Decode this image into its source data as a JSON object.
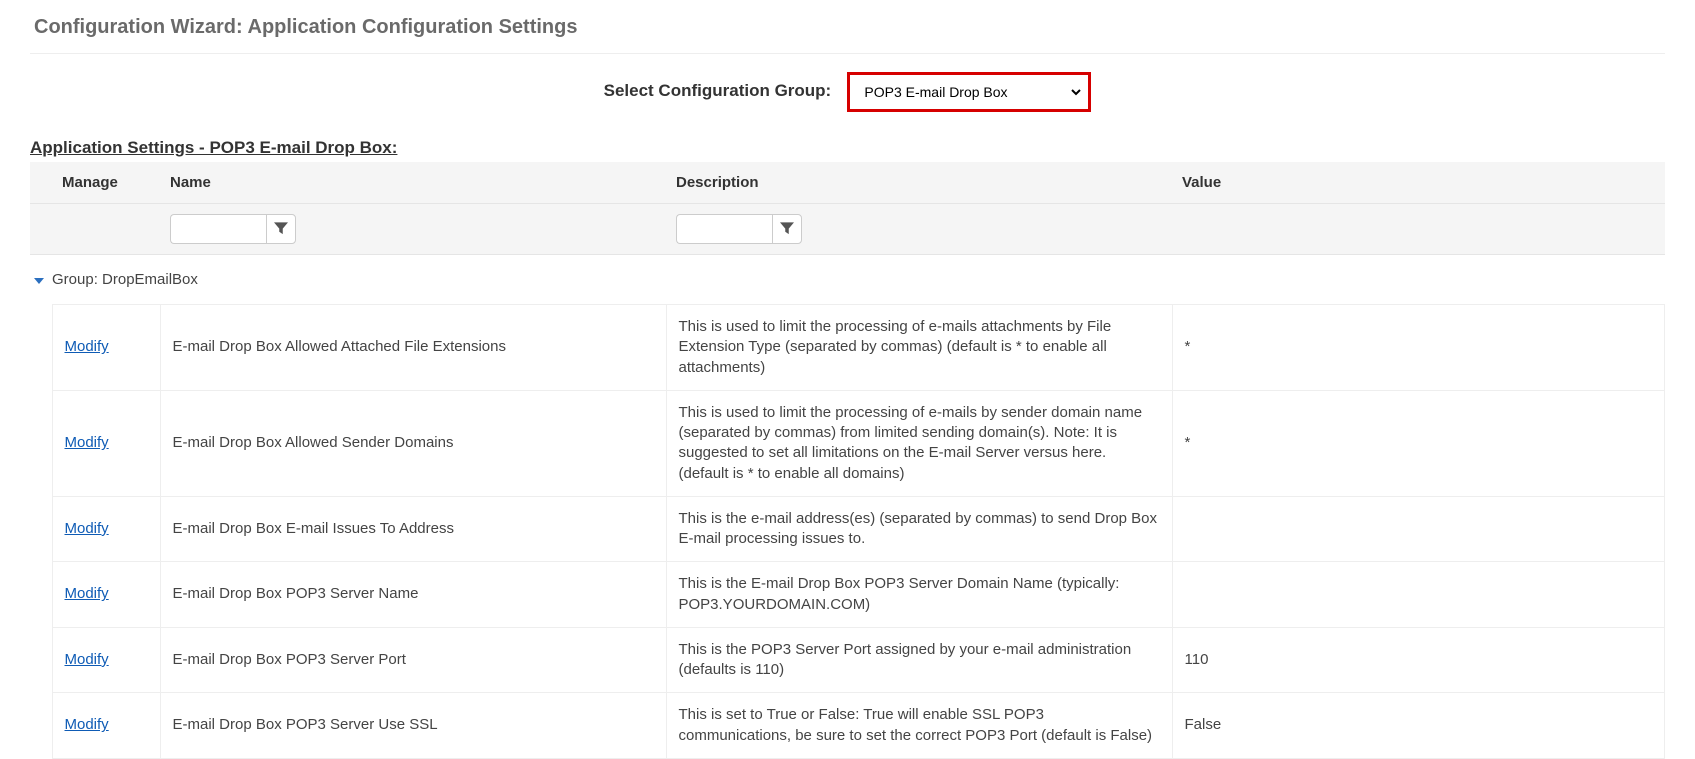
{
  "page_title": "Configuration Wizard: Application Configuration Settings",
  "select": {
    "label": "Select Configuration Group:",
    "value": "POP3 E-mail Drop Box"
  },
  "section_title": "Application Settings - POP3 E-mail Drop Box:",
  "columns": {
    "manage": "Manage",
    "name": "Name",
    "description": "Description",
    "value": "Value"
  },
  "group_label": "Group: DropEmailBox",
  "modify_label": "Modify",
  "rows": [
    {
      "name": "E-mail Drop Box Allowed Attached File Extensions",
      "description": "This is used to limit the processing of e-mails attachments by File Extension Type (separated by commas) (default is * to enable all attachments)",
      "value": "*"
    },
    {
      "name": "E-mail Drop Box Allowed Sender Domains",
      "description": "This is used to limit the processing of e-mails by sender domain name (separated by commas) from limited sending domain(s). Note: It is suggested to set all limitations on the E-mail Server versus here. (default is * to enable all domains)",
      "value": "*"
    },
    {
      "name": "E-mail Drop Box E-mail Issues To Address",
      "description": "This is the e-mail address(es) (separated by commas) to send Drop Box E-mail processing issues to.",
      "value": ""
    },
    {
      "name": "E-mail Drop Box POP3 Server Name",
      "description": "This is the E-mail Drop Box POP3 Server Domain Name (typically: POP3.YOURDOMAIN.COM)",
      "value": ""
    },
    {
      "name": "E-mail Drop Box POP3 Server Port",
      "description": "This is the POP3 Server Port assigned by your e-mail administration (defaults is 110)",
      "value": "110"
    },
    {
      "name": "E-mail Drop Box POP3 Server Use SSL",
      "description": "This is set to True or False: True will enable SSL POP3 communications, be sure to set the correct POP3 Port (default is False)",
      "value": "False"
    }
  ]
}
